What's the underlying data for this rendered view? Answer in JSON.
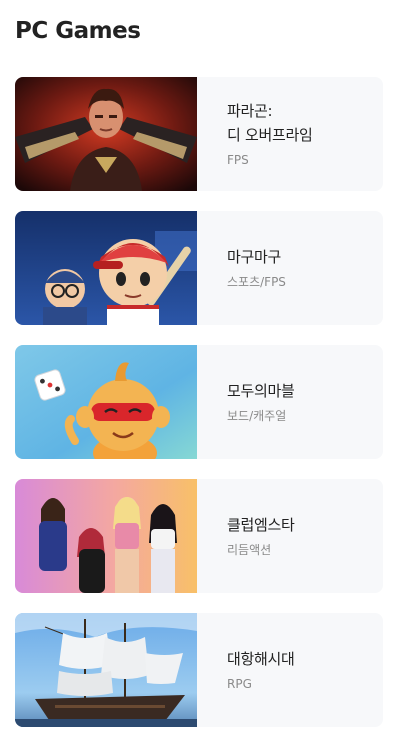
{
  "section": {
    "title": "PC Games"
  },
  "games": [
    {
      "title_line1": "파라곤:",
      "title_line2": "디 오버프라임",
      "genre": "FPS"
    },
    {
      "title_line1": "마구마구",
      "title_line2": "",
      "genre": "스포츠/FPS"
    },
    {
      "title_line1": "모두의마블",
      "title_line2": "",
      "genre": "보드/캐주얼"
    },
    {
      "title_line1": "클럽엠스타",
      "title_line2": "",
      "genre": "리듬액션"
    },
    {
      "title_line1": "대항해시대",
      "title_line2": "",
      "genre": "RPG"
    }
  ]
}
